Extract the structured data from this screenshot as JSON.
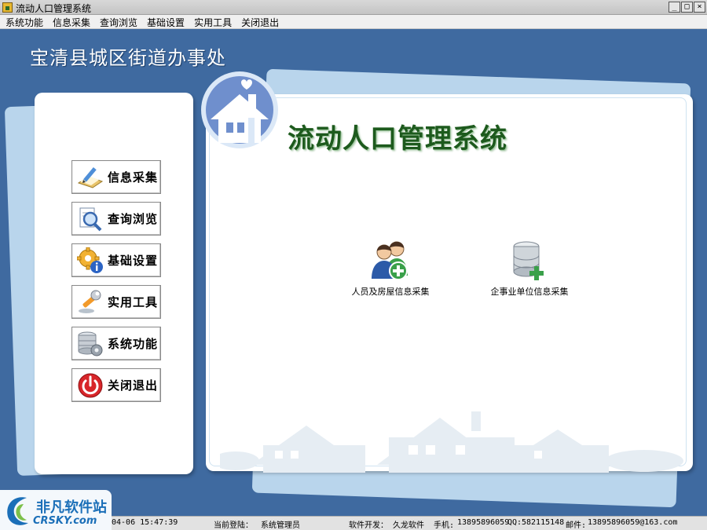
{
  "window": {
    "title": "流动人口管理系统",
    "controls": [
      "_",
      "□",
      "×"
    ]
  },
  "menu": [
    "系统功能",
    "信息采集",
    "查询浏览",
    "基础设置",
    "实用工具",
    "关闭退出"
  ],
  "org_title": "宝清县城区街道办事处",
  "system_title": "流动人口管理系统",
  "nav_buttons": [
    {
      "label": "信息采集",
      "icon": "pencil-paper-icon"
    },
    {
      "label": "查询浏览",
      "icon": "magnifier-icon"
    },
    {
      "label": "基础设置",
      "icon": "gear-info-icon"
    },
    {
      "label": "实用工具",
      "icon": "wrench-icon"
    },
    {
      "label": "系统功能",
      "icon": "server-gear-icon"
    },
    {
      "label": "关闭退出",
      "icon": "power-icon"
    }
  ],
  "features": [
    {
      "label": "人员及房屋信息采集",
      "icon": "people-add-icon"
    },
    {
      "label": "企事业单位信息采集",
      "icon": "database-add-icon"
    }
  ],
  "status": {
    "datetime": "04-06 15:47:39",
    "login_label": "当前登陆：",
    "login_user": "系统管理员",
    "developer_label": "软件开发：",
    "developer": "久龙软件",
    "phone_label": "手机:",
    "phone": "13895896059",
    "qq_label": "QQ:",
    "qq": "582115148",
    "email_label": "邮件:",
    "email": "13895896059@163.com"
  },
  "watermark": {
    "cn": "非凡软件站",
    "en": "CRSKY.com"
  }
}
